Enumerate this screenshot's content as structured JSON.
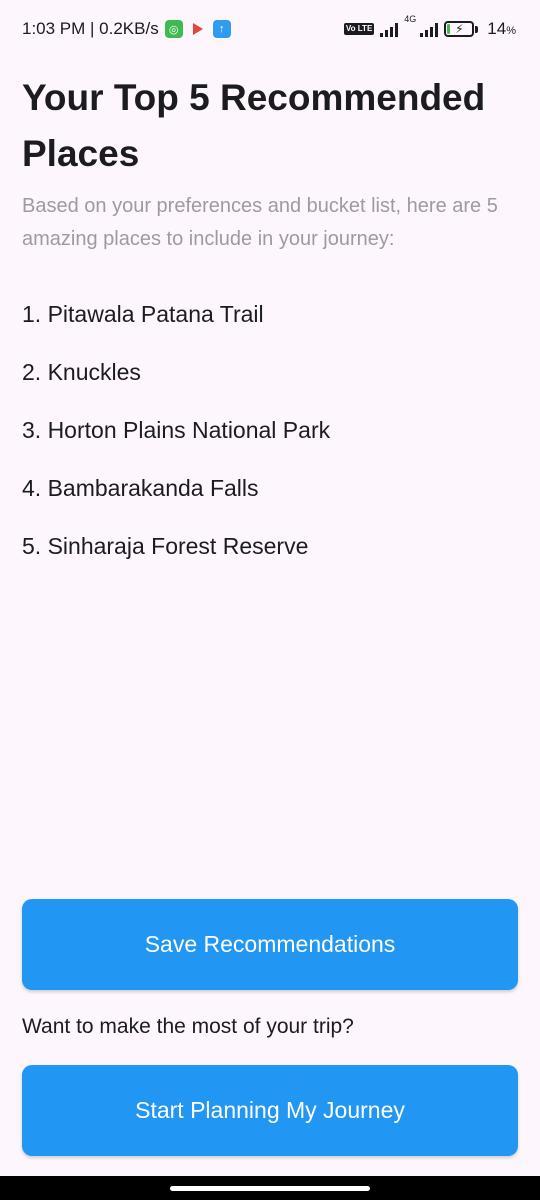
{
  "status_bar": {
    "time_speed": "1:03 PM | 0.2KB/s",
    "network_label": "4G",
    "volte_label": "Vo LTE",
    "battery_percent": "14",
    "battery_unit": "%",
    "battery_level": 0.14,
    "icons": [
      "whatsapp-icon",
      "play-store-icon",
      "upload-icon",
      "volte-icon",
      "signal-icon",
      "battery-icon"
    ]
  },
  "main": {
    "title": "Your Top 5 Recommended Places",
    "subtitle": "Based on your preferences and bucket list, here are 5 amazing places to include in your journey:",
    "places": [
      "1. Pitawala Patana Trail",
      "2. Knuckles",
      "3. Horton Plains National Park",
      "4. Bambarakanda Falls",
      "5. Sinharaja Forest Reserve"
    ]
  },
  "actions": {
    "save_label": "Save Recommendations",
    "prompt": "Want to make the most of your trip?",
    "plan_label": "Start Planning My Journey"
  },
  "colors": {
    "background": "#fdf7fd",
    "primary_button": "#2196f3",
    "subtitle_text": "#9e9aa2"
  }
}
